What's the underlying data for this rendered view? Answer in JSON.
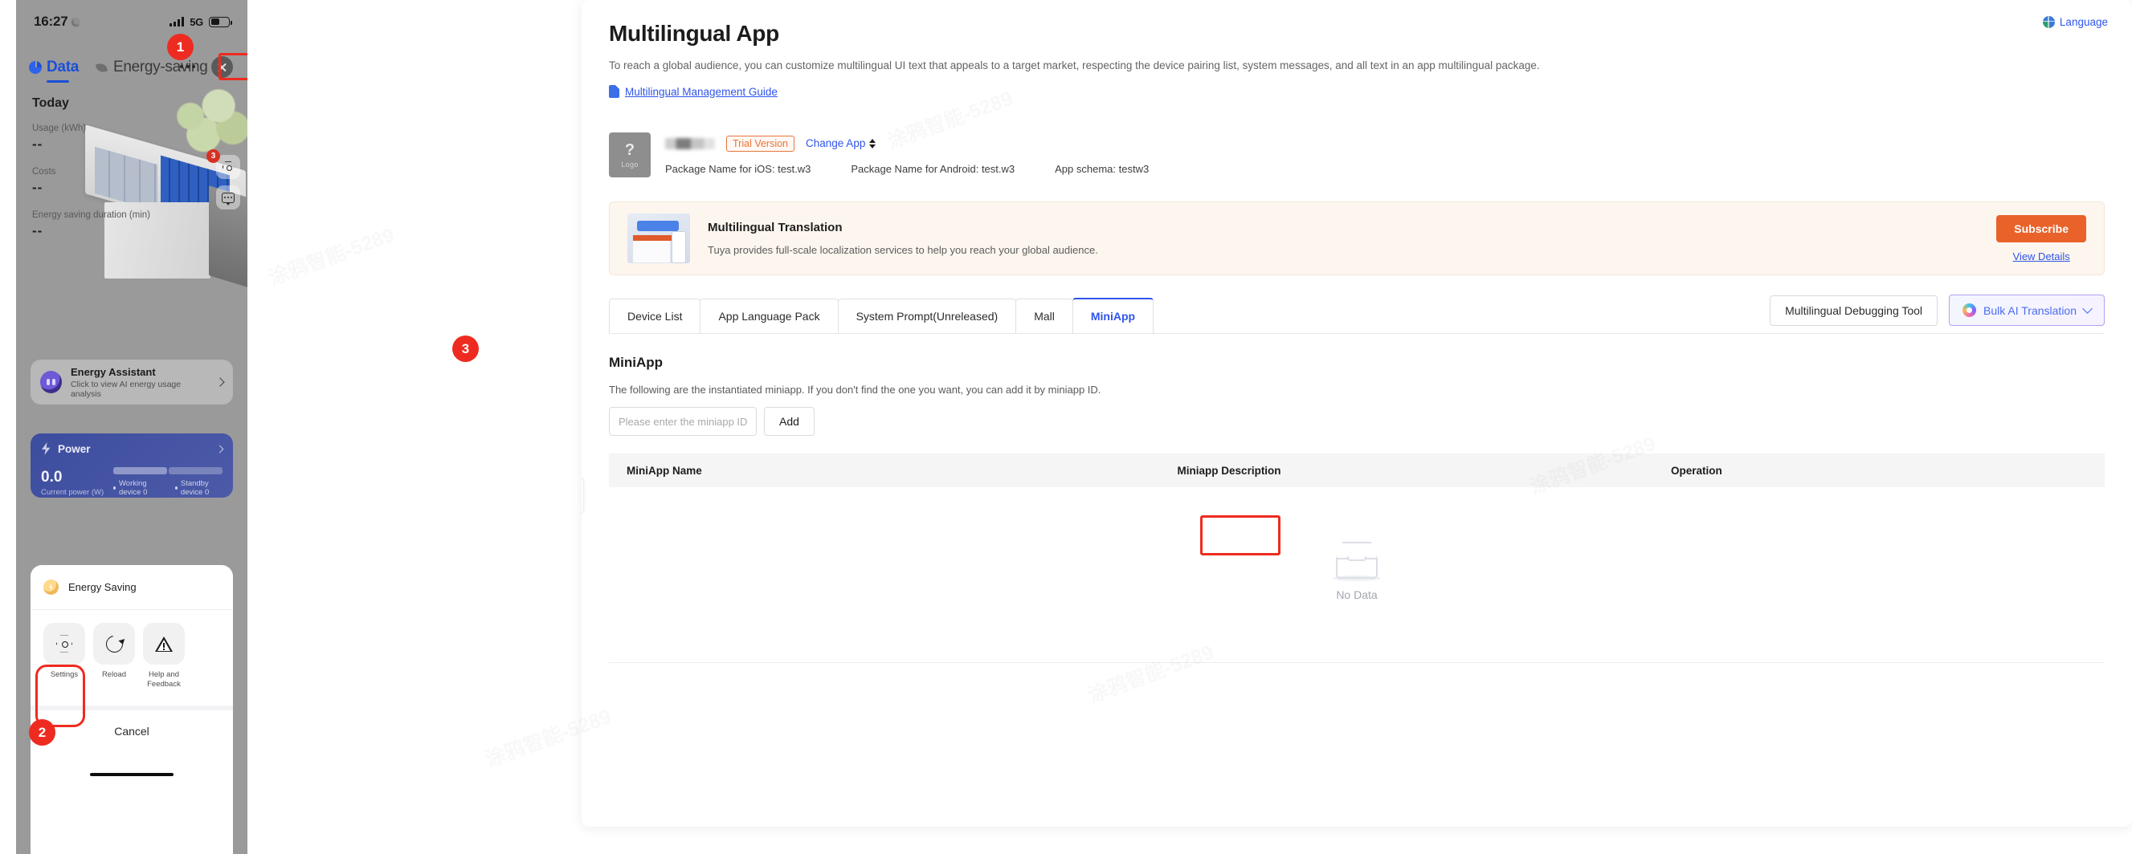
{
  "phone": {
    "status": {
      "time": "16:27",
      "network": "5G"
    },
    "tabs": [
      {
        "label": "Data",
        "icon": "pie-chart-icon",
        "active": true
      },
      {
        "label": "Energy-saving",
        "icon": "leaf-icon",
        "active": false
      }
    ],
    "more_icon": "more-dots-icon",
    "close_icon": "close-icon",
    "hero": {
      "today": "Today",
      "metrics": [
        {
          "label": "Usage (kWh)",
          "value": "--"
        },
        {
          "label": "Costs",
          "value": "--"
        },
        {
          "label": "Energy saving duration (min)",
          "value": "--"
        }
      ],
      "float_badge": "3"
    },
    "assistant": {
      "title": "Energy Assistant",
      "subtitle": "Click to view AI energy usage analysis"
    },
    "power": {
      "title": "Power",
      "value": "0.0",
      "unit_label": "Current power (W)",
      "working_label": "Working device 0",
      "standby_label": "Standby device 0"
    },
    "sheet": {
      "row_label": "Energy Saving",
      "actions": [
        {
          "label": "Settings",
          "icon": "gear-hex-icon"
        },
        {
          "label": "Reload",
          "icon": "reload-icon"
        },
        {
          "label": "Help and Feedback",
          "icon": "warning-triangle-icon"
        }
      ],
      "cancel": "Cancel"
    }
  },
  "steps": {
    "one": "1",
    "two": "2",
    "three": "3"
  },
  "panel": {
    "language_link": "Language",
    "title": "Multilingual App",
    "description": "To reach a global audience, you can customize multilingual UI text that appeals to a target market, respecting the device pairing list, system messages, and all text in an app multilingual package.",
    "guide_link": "Multilingual Management Guide",
    "app_card": {
      "logo_q": "?",
      "logo_text": "Logo",
      "trial_badge": "Trial Version",
      "change_app": "Change App",
      "package_ios": "Package Name for iOS: test.w3",
      "package_android": "Package Name for Android: test.w3",
      "app_schema": "App schema: testw3"
    },
    "promo": {
      "title": "Multilingual Translation",
      "text": "Tuya provides full-scale localization services to help you reach your global audience.",
      "subscribe": "Subscribe",
      "view_details": "View Details"
    },
    "tabs": [
      {
        "label": "Device List",
        "active": false
      },
      {
        "label": "App Language Pack",
        "active": false
      },
      {
        "label": "System Prompt(Unreleased)",
        "active": false
      },
      {
        "label": "Mall",
        "active": false
      },
      {
        "label": "MiniApp",
        "active": true
      }
    ],
    "tab_actions": {
      "debug_tool": "Multilingual Debugging Tool",
      "bulk_ai": "Bulk AI Translation"
    },
    "section": {
      "title": "MiniApp",
      "description": "The following are the instantiated miniapp. If you don't find the one you want, you can add it by miniapp ID.",
      "input_placeholder": "Please enter the miniapp ID",
      "input_value": "",
      "add_button": "Add"
    },
    "table": {
      "columns": [
        "MiniApp Name",
        "Miniapp Description",
        "Operation"
      ],
      "rows": [],
      "empty_text": "No Data"
    },
    "colors": {
      "accent_blue": "#2f54eb",
      "accent_orange": "#e8622a",
      "trial_orange": "#e8743a",
      "callout_red": "#ee2b20"
    }
  }
}
